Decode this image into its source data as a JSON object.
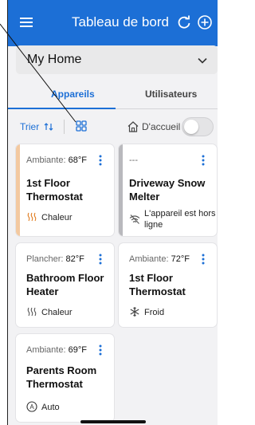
{
  "header": {
    "title": "Tableau de bord",
    "menu_icon": "menu-icon",
    "refresh_icon": "refresh-icon",
    "add_icon": "add-icon",
    "color": "#1c6fd6"
  },
  "home_selector": {
    "value": "My Home",
    "icon": "chevron-down-icon"
  },
  "tabs": [
    {
      "label": "Appareils",
      "active": true
    },
    {
      "label": "Utilisateurs",
      "active": false
    }
  ],
  "toolbar": {
    "sort_label": "Trier",
    "home_label": "D'accueil",
    "home_toggle_on": false
  },
  "devices": [
    {
      "meta_label": "Ambiante:",
      "meta_value": "68°F",
      "name": "1st Floor Thermostat",
      "status": "Chaleur",
      "status_icon": "heat-icon",
      "accent": "#f3c9a0"
    },
    {
      "meta_label": "---",
      "meta_value": "",
      "name": "Driveway Snow Melter",
      "status": "L'appareil est hors ligne",
      "status_icon": "wifi-off-icon",
      "accent": "#b9b9bd"
    },
    {
      "meta_label": "Plancher:",
      "meta_value": "82°F",
      "name": "Bathroom Floor Heater",
      "status": "Chaleur",
      "status_icon": "heat-icon",
      "accent": ""
    },
    {
      "meta_label": "Ambiante:",
      "meta_value": "72°F",
      "name": "1st Floor Thermostat",
      "status": "Froid",
      "status_icon": "snowflake-icon",
      "accent": ""
    },
    {
      "meta_label": "Ambiante:",
      "meta_value": "69°F",
      "name": "Parents Room Thermostat",
      "status": "Auto",
      "status_icon": "auto-icon",
      "accent": ""
    }
  ]
}
